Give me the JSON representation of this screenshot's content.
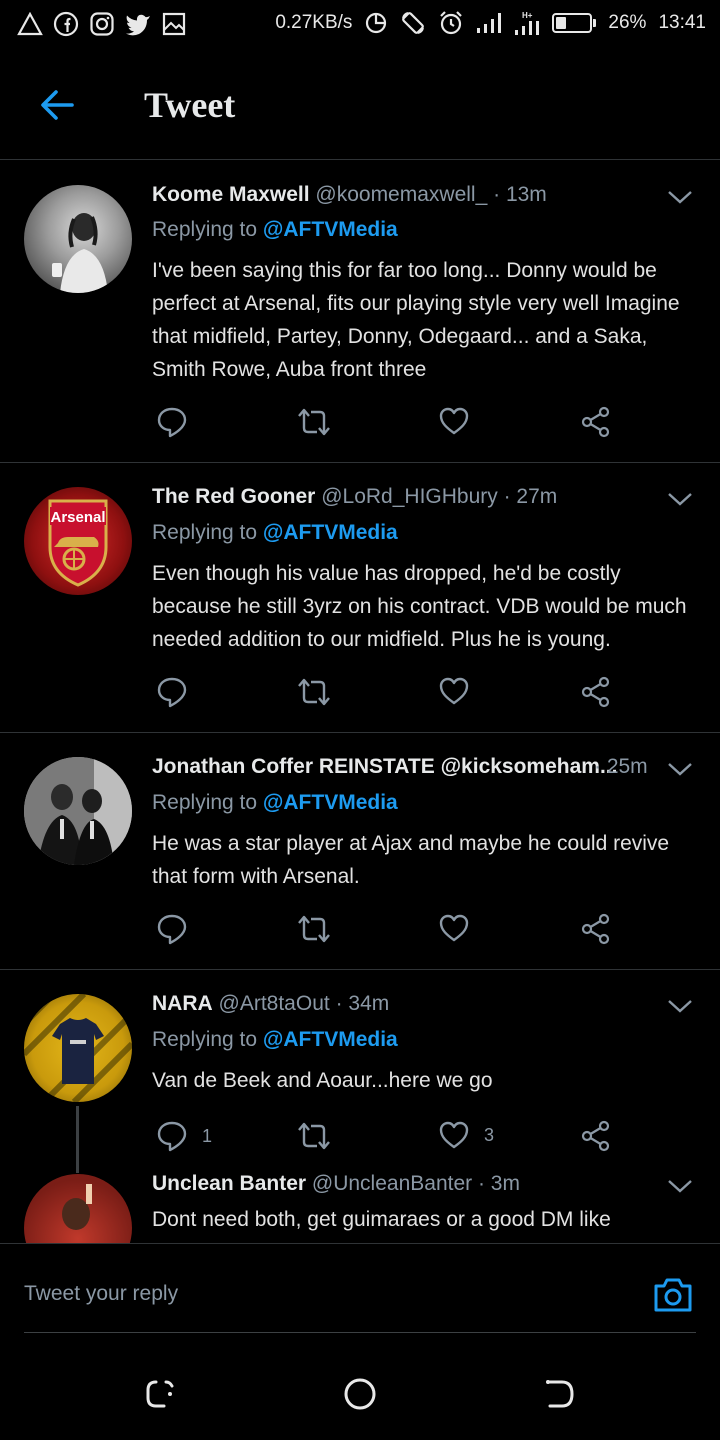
{
  "status_bar": {
    "speed": "0.27KB/s",
    "battery": "26%",
    "battery_level": 0.26,
    "time": "13:41",
    "icons": [
      "alert-icon",
      "facebook-icon",
      "instagram-icon",
      "twitter-icon",
      "gallery-icon",
      "data-saver-icon",
      "rotation-icon",
      "alarm-icon",
      "signal-icon",
      "signal-h-icon",
      "battery-icon"
    ]
  },
  "header": {
    "title": "Tweet",
    "back_icon": "back-arrow-icon"
  },
  "tweets": [
    {
      "name": "Koome Maxwell",
      "handle": "@koomemaxwell_",
      "time": "· 13m",
      "replying_prefix": "Replying to",
      "replying_to": "@AFTVMedia",
      "text": "I've been saying this for far too long... Donny would be perfect at Arsenal, fits our playing style very well Imagine that midfield, Partey, Donny, Odegaard... and a Saka, Smith Rowe, Auba front three",
      "replies": "",
      "retweets": "",
      "likes": ""
    },
    {
      "name": "The Red Gooner",
      "handle": "@LoRd_HIGHbury",
      "time": "· 27m",
      "replying_prefix": "Replying to",
      "replying_to": "@AFTVMedia",
      "avatar_text": "Arsenal",
      "text": "Even though his value has dropped, he'd be costly because he still 3yrz on his contract. VDB would be much needed addition to our midfield. Plus he is young.",
      "replies": "",
      "retweets": "",
      "likes": ""
    },
    {
      "name": "Jonathan Coffer REINSTATE",
      "handle": "@kicksomeham...",
      "time": "· 25m",
      "replying_prefix": "Replying to",
      "replying_to": "@AFTVMedia",
      "text": "He was a star player at Ajax and maybe he could revive that form with Arsenal.",
      "replies": "",
      "retweets": "",
      "likes": ""
    },
    {
      "name": "NARA",
      "handle": "@Art8taOut",
      "time": "· 34m",
      "replying_prefix": "Replying to",
      "replying_to": "@AFTVMedia",
      "text": "Van de Beek and Aoaur...here we go",
      "replies": "1",
      "retweets": "",
      "likes": "3"
    },
    {
      "name": "Unclean Banter",
      "handle": "@UncleanBanter",
      "time": "· 3m",
      "text": "Dont need both, get guimaraes or a good DM like"
    }
  ],
  "reply_bar": {
    "placeholder": "Tweet your reply",
    "camera_icon": "camera-icon"
  },
  "nav_bar": {
    "icons": [
      "recent-apps-icon",
      "home-icon",
      "back-icon"
    ]
  },
  "colors": {
    "background": "#000000",
    "accent": "#1d9bf0",
    "secondary_text": "#8b98a5",
    "divider": "#2f3336"
  }
}
